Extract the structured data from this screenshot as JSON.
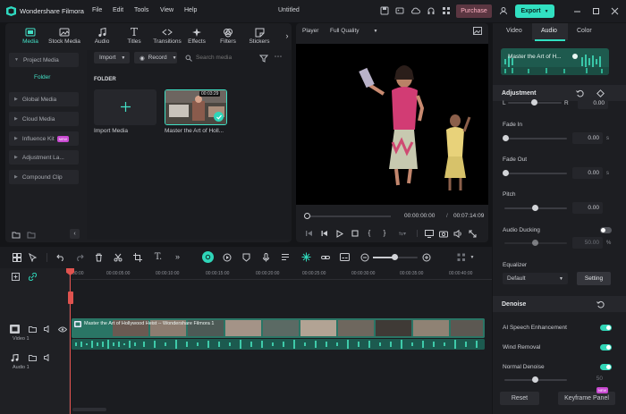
{
  "app": {
    "name": "Wondershare Filmora",
    "menu": [
      "File",
      "Edit",
      "Tools",
      "View",
      "Help"
    ],
    "project_title": "Untitled",
    "purchase_label": "Purchase",
    "export_label": "Export"
  },
  "toolbar": {
    "tools": [
      "Media",
      "Stock Media",
      "Audio",
      "Titles",
      "Transitions",
      "Effects",
      "Filters",
      "Stickers"
    ],
    "active": "Media"
  },
  "library": {
    "sidebar": [
      {
        "label": "Project Media",
        "expanded": true
      },
      {
        "label": "Folder",
        "selected": true
      },
      {
        "label": "Global Media"
      },
      {
        "label": "Cloud Media"
      },
      {
        "label": "Influence Kit",
        "badge": "NEW"
      },
      {
        "label": "Adjustment La..."
      },
      {
        "label": "Compound Clip"
      }
    ],
    "import_label": "Import",
    "record_label": "Record",
    "search_placeholder": "Search media",
    "folder_heading": "FOLDER",
    "items": [
      {
        "label": "Import Media"
      },
      {
        "label": "Master the Art of Holl...",
        "duration": "00:03:29"
      }
    ]
  },
  "player": {
    "label": "Player",
    "quality": "Full Quality",
    "current_time": "00:00:00:00",
    "total_time": "00:07:14:09"
  },
  "properties": {
    "tabs": [
      "Video",
      "Audio",
      "Color"
    ],
    "active_tab": "Audio",
    "clip_name": "Master the Art of H...",
    "adjustment_heading": "Adjustment",
    "balance": {
      "left": "L",
      "right": "R",
      "value": "0.00"
    },
    "fade_in": {
      "label": "Fade In",
      "value": "0.00",
      "unit": "s"
    },
    "fade_out": {
      "label": "Fade Out",
      "value": "0.00",
      "unit": "s"
    },
    "pitch": {
      "label": "Pitch",
      "value": "0.00"
    },
    "audio_ducking": {
      "label": "Audio Ducking",
      "value": "50.00",
      "unit": "%"
    },
    "equalizer": {
      "label": "Equalizer",
      "preset": "Default",
      "setting_label": "Setting"
    },
    "denoise_heading": "Denoise",
    "denoise_items": [
      {
        "label": "AI Speech Enhancement",
        "on": true
      },
      {
        "label": "Wind Removal",
        "on": true
      },
      {
        "label": "Normal Denoise",
        "on": true
      }
    ],
    "normal_denoise_value": "50",
    "reset_label": "Reset",
    "keyframe_label": "Keyframe Panel",
    "keyframe_badge": "NEW"
  },
  "timeline": {
    "ruler_ticks": [
      "00:00",
      "00:00:05:00",
      "00:00:10:00",
      "00:00:15:00",
      "00:00:20:00",
      "00:00:25:00",
      "00:00:30:00",
      "00:00:35:00",
      "00:00:40:00"
    ],
    "video_track_label": "Video 1",
    "audio_track_label": "Audio 1",
    "clip_title": "Master the Art of Hollywood Heist -- Wondershare Filmora 1"
  },
  "colors": {
    "accent": "#31e0c1",
    "playhead": "#e0534f",
    "clip_video": "#2a7565",
    "clip_audio": "#1c5a4f"
  }
}
